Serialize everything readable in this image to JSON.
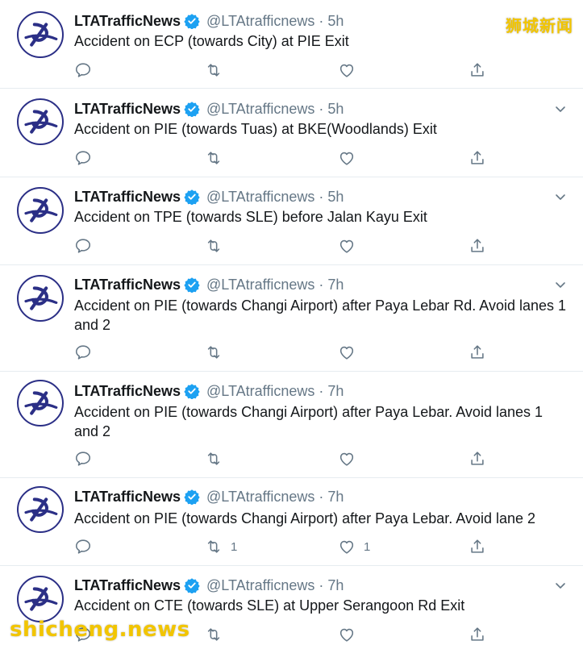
{
  "colors": {
    "text_primary": "#14171a",
    "text_secondary": "#657786",
    "verified_blue": "#1da1f2",
    "divider": "#e6ecf0",
    "avatar_navy": "#2b2f86",
    "watermark_yellow": "#f2c500"
  },
  "icons": {
    "reply": "reply-icon",
    "retweet": "retweet-icon",
    "like": "heart-icon",
    "share": "share-icon",
    "verified": "verified-badge-icon",
    "more": "chevron-down-icon"
  },
  "watermarks": {
    "top_right": "狮城新闻",
    "bottom_left": "shicheng.news"
  },
  "tweets": [
    {
      "name": "LTATrafficNews",
      "handle": "@LTAtrafficnews",
      "separator": "·",
      "time": "5h",
      "text": "Accident on ECP (towards City) at PIE Exit",
      "retweets": "",
      "likes": ""
    },
    {
      "name": "LTATrafficNews",
      "handle": "@LTAtrafficnews",
      "separator": "·",
      "time": "5h",
      "text": "Accident on PIE (towards Tuas) at BKE(Woodlands) Exit",
      "retweets": "",
      "likes": ""
    },
    {
      "name": "LTATrafficNews",
      "handle": "@LTAtrafficnews",
      "separator": "·",
      "time": "5h",
      "text": "Accident on TPE (towards SLE) before Jalan Kayu Exit",
      "retweets": "",
      "likes": ""
    },
    {
      "name": "LTATrafficNews",
      "handle": "@LTAtrafficnews",
      "separator": "·",
      "time": "7h",
      "text": "Accident on PIE (towards Changi Airport) after Paya Lebar Rd. Avoid lanes 1 and 2",
      "retweets": "",
      "likes": ""
    },
    {
      "name": "LTATrafficNews",
      "handle": "@LTAtrafficnews",
      "separator": "·",
      "time": "7h",
      "text": "Accident on PIE (towards Changi Airport) after Paya Lebar. Avoid lanes 1 and 2",
      "retweets": "",
      "likes": ""
    },
    {
      "name": "LTATrafficNews",
      "handle": "@LTAtrafficnews",
      "separator": "·",
      "time": "7h",
      "text": "Accident on PIE (towards Changi Airport) after Paya Lebar. Avoid lane 2",
      "retweets": "1",
      "likes": "1"
    },
    {
      "name": "LTATrafficNews",
      "handle": "@LTAtrafficnews",
      "separator": "·",
      "time": "7h",
      "text": "Accident on CTE (towards SLE) at Upper Serangoon Rd Exit",
      "retweets": "",
      "likes": ""
    }
  ]
}
